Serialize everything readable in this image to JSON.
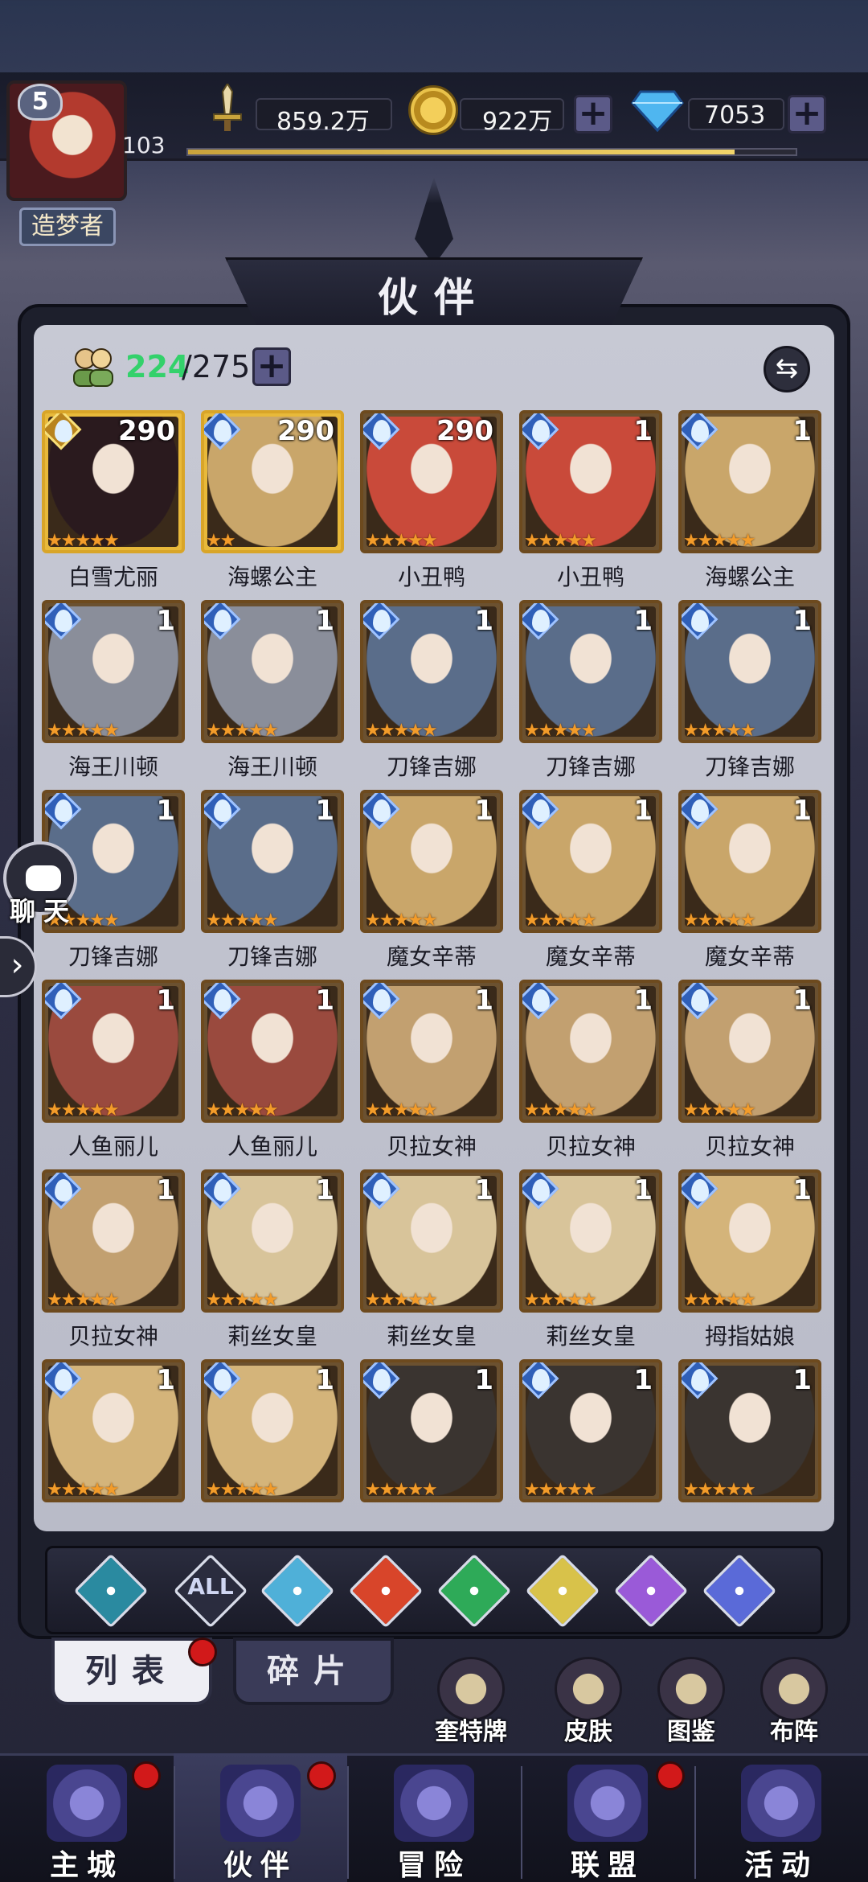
{
  "player": {
    "avatar_level": "5",
    "level": "103",
    "title": "造梦者",
    "exp_fraction": 0.9
  },
  "resources": {
    "power": "859.2万",
    "gold": "922万",
    "gems": "7053"
  },
  "header": {
    "title": "伙伴"
  },
  "roster": {
    "count_current": "224",
    "count_max": "/275"
  },
  "heroes": [
    {
      "name": "白雪尤丽",
      "level": "290",
      "stars": 5,
      "frame": "gold",
      "element": "gold",
      "tint": "#2a1a1e"
    },
    {
      "name": "海螺公主",
      "level": "290",
      "stars": 2,
      "frame": "gold",
      "element": "water",
      "tint": "#c9a66a"
    },
    {
      "name": "小丑鸭",
      "level": "290",
      "stars": 5,
      "frame": "bronze",
      "element": "water",
      "tint": "#c94a3a"
    },
    {
      "name": "小丑鸭",
      "level": "1",
      "stars": 5,
      "frame": "bronze",
      "element": "water",
      "tint": "#c94a3a"
    },
    {
      "name": "海螺公主",
      "level": "1",
      "stars": 5,
      "frame": "bronze",
      "element": "water",
      "tint": "#c9a66a"
    },
    {
      "name": "海王川顿",
      "level": "1",
      "stars": 5,
      "frame": "bronze",
      "element": "water",
      "tint": "#8a8e9a"
    },
    {
      "name": "海王川顿",
      "level": "1",
      "stars": 5,
      "frame": "bronze",
      "element": "water",
      "tint": "#8a8e9a"
    },
    {
      "name": "刀锋吉娜",
      "level": "1",
      "stars": 5,
      "frame": "bronze",
      "element": "water",
      "tint": "#5a6d8a"
    },
    {
      "name": "刀锋吉娜",
      "level": "1",
      "stars": 5,
      "frame": "bronze",
      "element": "water",
      "tint": "#5a6d8a"
    },
    {
      "name": "刀锋吉娜",
      "level": "1",
      "stars": 5,
      "frame": "bronze",
      "element": "water",
      "tint": "#5a6d8a"
    },
    {
      "name": "刀锋吉娜",
      "level": "1",
      "stars": 5,
      "frame": "bronze",
      "element": "water",
      "tint": "#5a6d8a"
    },
    {
      "name": "刀锋吉娜",
      "level": "1",
      "stars": 5,
      "frame": "bronze",
      "element": "water",
      "tint": "#5a6d8a"
    },
    {
      "name": "魔女辛蒂",
      "level": "1",
      "stars": 5,
      "frame": "bronze",
      "element": "water",
      "tint": "#c9a66a"
    },
    {
      "name": "魔女辛蒂",
      "level": "1",
      "stars": 5,
      "frame": "bronze",
      "element": "water",
      "tint": "#c9a66a"
    },
    {
      "name": "魔女辛蒂",
      "level": "1",
      "stars": 5,
      "frame": "bronze",
      "element": "water",
      "tint": "#c9a66a"
    },
    {
      "name": "人鱼丽儿",
      "level": "1",
      "stars": 5,
      "frame": "bronze",
      "element": "water",
      "tint": "#9a4a3e"
    },
    {
      "name": "人鱼丽儿",
      "level": "1",
      "stars": 5,
      "frame": "bronze",
      "element": "water",
      "tint": "#9a4a3e"
    },
    {
      "name": "贝拉女神",
      "level": "1",
      "stars": 5,
      "frame": "bronze",
      "element": "water",
      "tint": "#c2a070"
    },
    {
      "name": "贝拉女神",
      "level": "1",
      "stars": 5,
      "frame": "bronze",
      "element": "water",
      "tint": "#c2a070"
    },
    {
      "name": "贝拉女神",
      "level": "1",
      "stars": 5,
      "frame": "bronze",
      "element": "water",
      "tint": "#c2a070"
    },
    {
      "name": "贝拉女神",
      "level": "1",
      "stars": 5,
      "frame": "bronze",
      "element": "water",
      "tint": "#c2a070"
    },
    {
      "name": "莉丝女皇",
      "level": "1",
      "stars": 5,
      "frame": "bronze",
      "element": "water",
      "tint": "#d8c49a"
    },
    {
      "name": "莉丝女皇",
      "level": "1",
      "stars": 5,
      "frame": "bronze",
      "element": "water",
      "tint": "#d8c49a"
    },
    {
      "name": "莉丝女皇",
      "level": "1",
      "stars": 5,
      "frame": "bronze",
      "element": "water",
      "tint": "#d8c49a"
    },
    {
      "name": "拇指姑娘",
      "level": "1",
      "stars": 5,
      "frame": "bronze",
      "element": "water",
      "tint": "#d4b47a"
    },
    {
      "name": "",
      "level": "1",
      "stars": 5,
      "frame": "bronze",
      "element": "water",
      "tint": "#d4b47a"
    },
    {
      "name": "",
      "level": "1",
      "stars": 5,
      "frame": "bronze",
      "element": "water",
      "tint": "#d4b47a"
    },
    {
      "name": "",
      "level": "1",
      "stars": 5,
      "frame": "bronze",
      "element": "water",
      "tint": "#3a3430"
    },
    {
      "name": "",
      "level": "1",
      "stars": 5,
      "frame": "bronze",
      "element": "water",
      "tint": "#3a3430"
    },
    {
      "name": "",
      "level": "1",
      "stars": 5,
      "frame": "bronze",
      "element": "water",
      "tint": "#3a3430"
    }
  ],
  "filters": [
    {
      "name": "diamond",
      "label": "",
      "color": "#2a8aa0"
    },
    {
      "name": "all",
      "label": "ALL",
      "color": "#c8d2ee"
    },
    {
      "name": "water",
      "label": "",
      "color": "#4fb0d8"
    },
    {
      "name": "fire",
      "label": "",
      "color": "#d8452a"
    },
    {
      "name": "wind",
      "label": "",
      "color": "#2eaa58"
    },
    {
      "name": "light",
      "label": "",
      "color": "#d8c24a"
    },
    {
      "name": "dark",
      "label": "",
      "color": "#9a5ad8"
    },
    {
      "name": "cosmic",
      "label": "",
      "color": "#5a6ad8"
    }
  ],
  "tabs": {
    "list": "列表",
    "fragments": "碎片"
  },
  "shortcuts": [
    "奎特牌",
    "皮肤",
    "图鉴",
    "布阵"
  ],
  "chat": {
    "label": "聊天"
  },
  "nav": [
    "主城",
    "伙伴",
    "冒险",
    "联盟",
    "活动"
  ],
  "colors": {
    "accent_gold": "#e8b93a",
    "count_green": "#33d16b",
    "badge_red": "#d2191a"
  }
}
